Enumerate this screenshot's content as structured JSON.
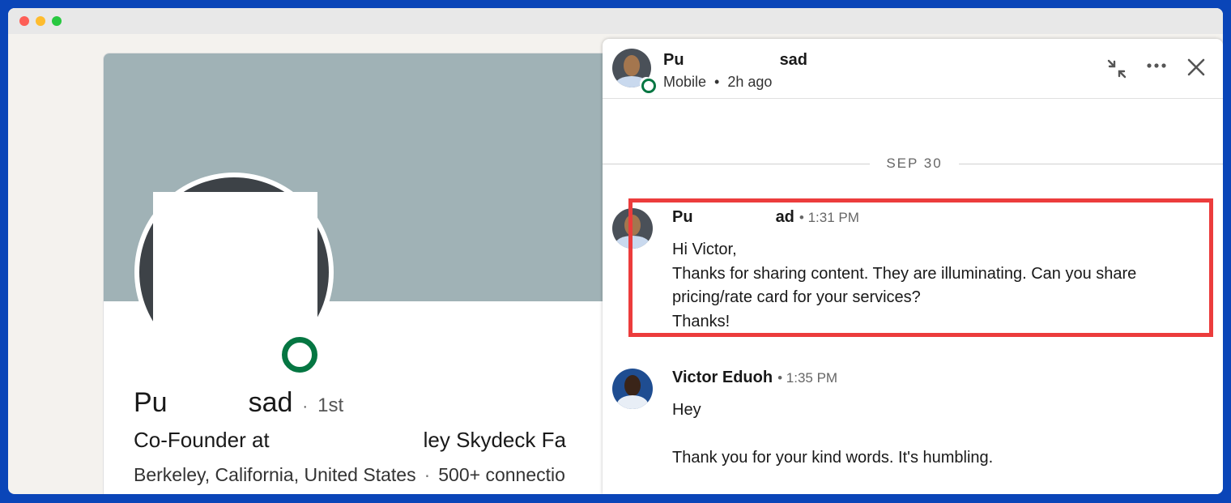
{
  "window": {
    "controls": [
      "close",
      "minimize",
      "zoom"
    ]
  },
  "profile": {
    "name_start": "Pu",
    "name_end": "sad",
    "separator": "·",
    "degree": "1st",
    "headline_start": "Co-Founder at",
    "headline_end": "ley Skydeck Fa",
    "location": "Berkeley, California, United States",
    "location_separator": "·",
    "connections": "500+ connectio"
  },
  "chat": {
    "header": {
      "name_start": "Pu",
      "name_end": "sad",
      "device": "Mobile",
      "bullet": "•",
      "last_active": "2h ago",
      "compress_icon": "compress-icon",
      "more_icon": "more-icon",
      "close_icon": "close-icon"
    },
    "date_divider": "SEP 30",
    "messages": [
      {
        "sender_start": "Pu",
        "sender_end": "ad",
        "time": "• 1:31 PM",
        "lines": [
          "Hi Victor,",
          "Thanks for sharing content. They are illuminating. Can you share",
          "pricing/rate card for your services?",
          "Thanks!"
        ]
      },
      {
        "sender": "Victor Eduoh",
        "time": "• 1:35 PM",
        "lines": [
          "Hey",
          "",
          "Thank you for your kind words. It's humbling."
        ]
      }
    ]
  },
  "colors": {
    "background": "#0a45b8",
    "banner": "#a0b2b6",
    "online": "#057642",
    "highlight": "#ec3c3c"
  }
}
